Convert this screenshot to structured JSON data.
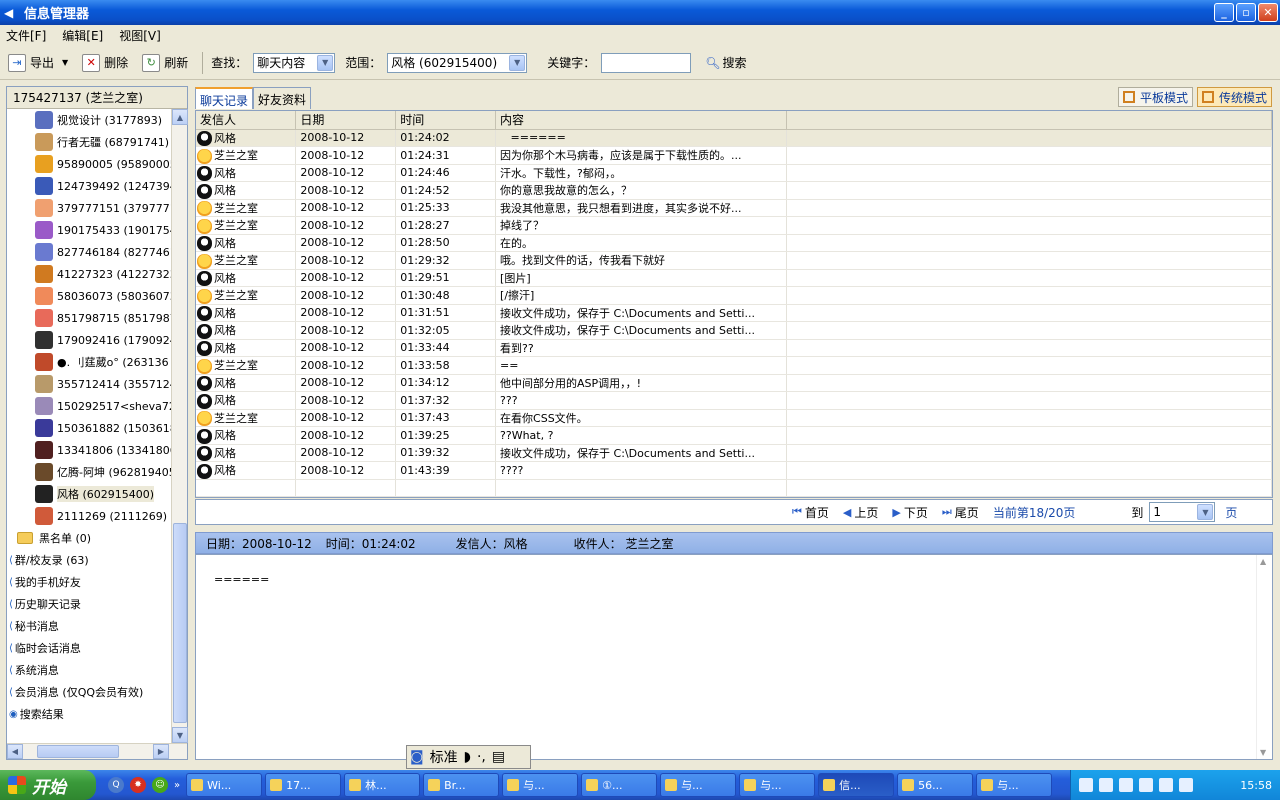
{
  "window": {
    "title": "信息管理器"
  },
  "menu": [
    "文件[F]",
    "编辑[E]",
    "视图[V]"
  ],
  "toolbar": {
    "export_label": "导出",
    "delete_label": "删除",
    "refresh_label": "刷新",
    "find_label": "查找：",
    "find_value": "聊天内容",
    "range_label": "范围：",
    "range_value": "风格 (602915400)",
    "keyword_label": "关键字：",
    "keyword_value": "",
    "search_label": "搜索"
  },
  "left_panel": {
    "header": "175427137 (芝兰之室)",
    "contacts": [
      "视觉设计 (3177893)",
      "行者无疆 (68791741)",
      "95890005 (95890005)",
      "124739492 (124739492",
      "379777151 (379777151",
      "190175433 (190175433",
      "827746184 (82774618",
      "41227323 (41227323)",
      "58036073 (58036073)",
      "851798715 (851798715",
      "179092416 (17909241",
      "●. 刂莛葳o° (263136",
      "355712414 (35571241",
      "150292517<sheva7251",
      "150361882 (15036188",
      "13341806 (13341806)",
      "亿腾-阿坤 (962819405",
      "风格 (602915400)",
      "2111269 (2111269)"
    ],
    "groups": [
      "黑名单 (0)"
    ],
    "top_items": [
      "群/校友录 (63)",
      "我的手机好友",
      "历史聊天记录",
      "秘书消息",
      "临时会话消息",
      "系统消息",
      "会员消息 (仅QQ会员有效)",
      "搜索结果"
    ]
  },
  "tabs": [
    "聊天记录",
    "好友资料"
  ],
  "modes": {
    "flat": "平板模式",
    "classic": "传统模式"
  },
  "table": {
    "headers": [
      "发信人",
      "日期",
      "时间",
      "内容"
    ],
    "rows": [
      [
        "风格",
        "2008-10-12",
        "01:24:02",
        "   ======"
      ],
      [
        "芝兰之室",
        "2008-10-12",
        "01:24:31",
        "因为你那个木马病毒，应该是属于下载性质的。..."
      ],
      [
        "风格",
        "2008-10-12",
        "01:24:46",
        "汗水。下载性，?郁闷，。"
      ],
      [
        "风格",
        "2008-10-12",
        "01:24:52",
        "你的意思我故意的怎么，？"
      ],
      [
        "芝兰之室",
        "2008-10-12",
        "01:25:33",
        "我没其他意思，我只想看到进度，其实多说不好..."
      ],
      [
        "芝兰之室",
        "2008-10-12",
        "01:28:27",
        "掉线了？"
      ],
      [
        "风格",
        "2008-10-12",
        "01:28:50",
        "在的。"
      ],
      [
        "芝兰之室",
        "2008-10-12",
        "01:29:32",
        "哦。找到文件的话，传我看下就好"
      ],
      [
        "风格",
        "2008-10-12",
        "01:29:51",
        "[图片]"
      ],
      [
        "芝兰之室",
        "2008-10-12",
        "01:30:48",
        "[/擦汗]"
      ],
      [
        "风格",
        "2008-10-12",
        "01:31:51",
        "接收文件成功，保存于 C:\\Documents and Setti..."
      ],
      [
        "风格",
        "2008-10-12",
        "01:32:05",
        "接收文件成功，保存于 C:\\Documents and Setti..."
      ],
      [
        "风格",
        "2008-10-12",
        "01:33:44",
        "看到??"
      ],
      [
        "芝兰之室",
        "2008-10-12",
        "01:33:58",
        "=="
      ],
      [
        "风格",
        "2008-10-12",
        "01:34:12",
        "他中间部分用的ASP调用，，!"
      ],
      [
        "风格",
        "2008-10-12",
        "01:37:32",
        "???"
      ],
      [
        "芝兰之室",
        "2008-10-12",
        "01:37:43",
        "在看你CSS文件。"
      ],
      [
        "风格",
        "2008-10-12",
        "01:39:25",
        "??What, ?"
      ],
      [
        "风格",
        "2008-10-12",
        "01:39:32",
        "接收文件成功，保存于 C:\\Documents and Setti..."
      ],
      [
        "风格",
        "2008-10-12",
        "01:43:39",
        "????"
      ]
    ]
  },
  "pager": {
    "first": "首页",
    "prev": "上页",
    "next": "下页",
    "last": "尾页",
    "status": "当前第18/20页",
    "goto_label": "到",
    "page_value": "1",
    "page_suffix": "页"
  },
  "detail": {
    "date": "日期：2008-10-12",
    "time": "时间：01:24:02",
    "sender": "发信人：风格",
    "recipient": "收件人：  芝兰之室",
    "message": "======"
  },
  "ime": {
    "mode": "标准"
  },
  "taskbar": {
    "start": "开始",
    "tasks": [
      "Wi...",
      "17...",
      "林...",
      "Br...",
      "与...",
      "①...",
      "与...",
      "与...",
      "信...",
      "56...",
      "与..."
    ],
    "clock": "15:58"
  }
}
